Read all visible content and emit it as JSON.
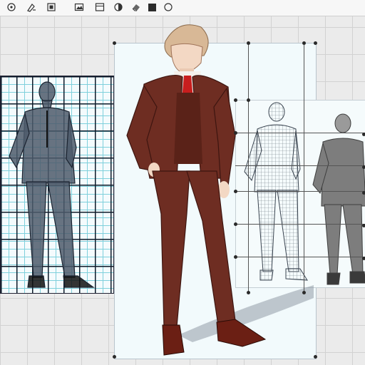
{
  "toolbar": {
    "tools": [
      {
        "icon": "settings-icon"
      },
      {
        "icon": "pen-tool-icon"
      },
      {
        "icon": "layer-icon"
      },
      {
        "icon": "image-icon"
      },
      {
        "icon": "color-picker-icon"
      },
      {
        "icon": "eraser-icon"
      },
      {
        "icon": "fill-color-icon"
      }
    ],
    "fill_color": "#2b2b2b"
  },
  "figures": [
    {
      "name": "blueprint-sketch",
      "style": "blueprint"
    },
    {
      "name": "main-character",
      "style": "color",
      "suit_color": "#6e2d22",
      "tie_color": "#c81e1e",
      "shoe_color": "#6b1f14",
      "hair_color": "#d8b896"
    },
    {
      "name": "wireframe-sketch",
      "style": "wireframe"
    },
    {
      "name": "grayscale-render",
      "style": "grayscale"
    }
  ]
}
